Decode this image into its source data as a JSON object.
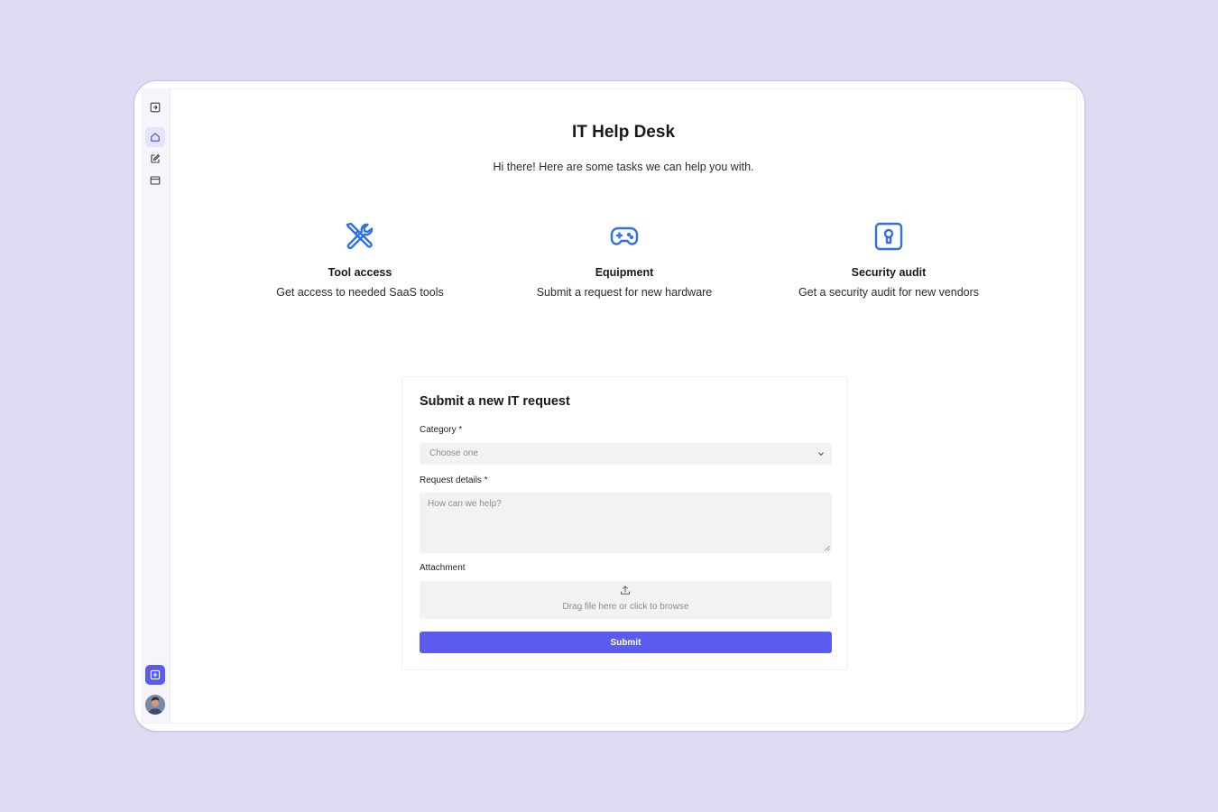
{
  "app": {
    "title": "IT Help Desk",
    "subtitle": "Hi there! Here are some tasks we can help you with."
  },
  "sidebar": {
    "items": [
      {
        "icon": "expand-panel-icon"
      },
      {
        "icon": "home-icon",
        "active": true
      },
      {
        "icon": "edit-icon"
      },
      {
        "icon": "window-icon"
      }
    ],
    "bottom": [
      {
        "icon": "add-icon"
      },
      {
        "icon": "user-avatar"
      }
    ]
  },
  "tasks": [
    {
      "icon": "tools-icon",
      "title": "Tool access",
      "description": "Get access to needed SaaS tools"
    },
    {
      "icon": "gamepad-icon",
      "title": "Equipment",
      "description": "Submit a request for new hardware"
    },
    {
      "icon": "lock-icon",
      "title": "Security audit",
      "description": "Get a security audit for new vendors"
    }
  ],
  "form": {
    "title": "Submit a new IT request",
    "category_label": "Category *",
    "category_placeholder": "Choose one",
    "details_label": "Request details *",
    "details_placeholder": "How can we help?",
    "attachment_label": "Attachment",
    "attachment_hint": "Drag file here or click to browse",
    "submit_label": "Submit"
  },
  "colors": {
    "accent": "#5b5bf0",
    "icon_blue": "#2f6fed",
    "background": "#e0daf3"
  }
}
